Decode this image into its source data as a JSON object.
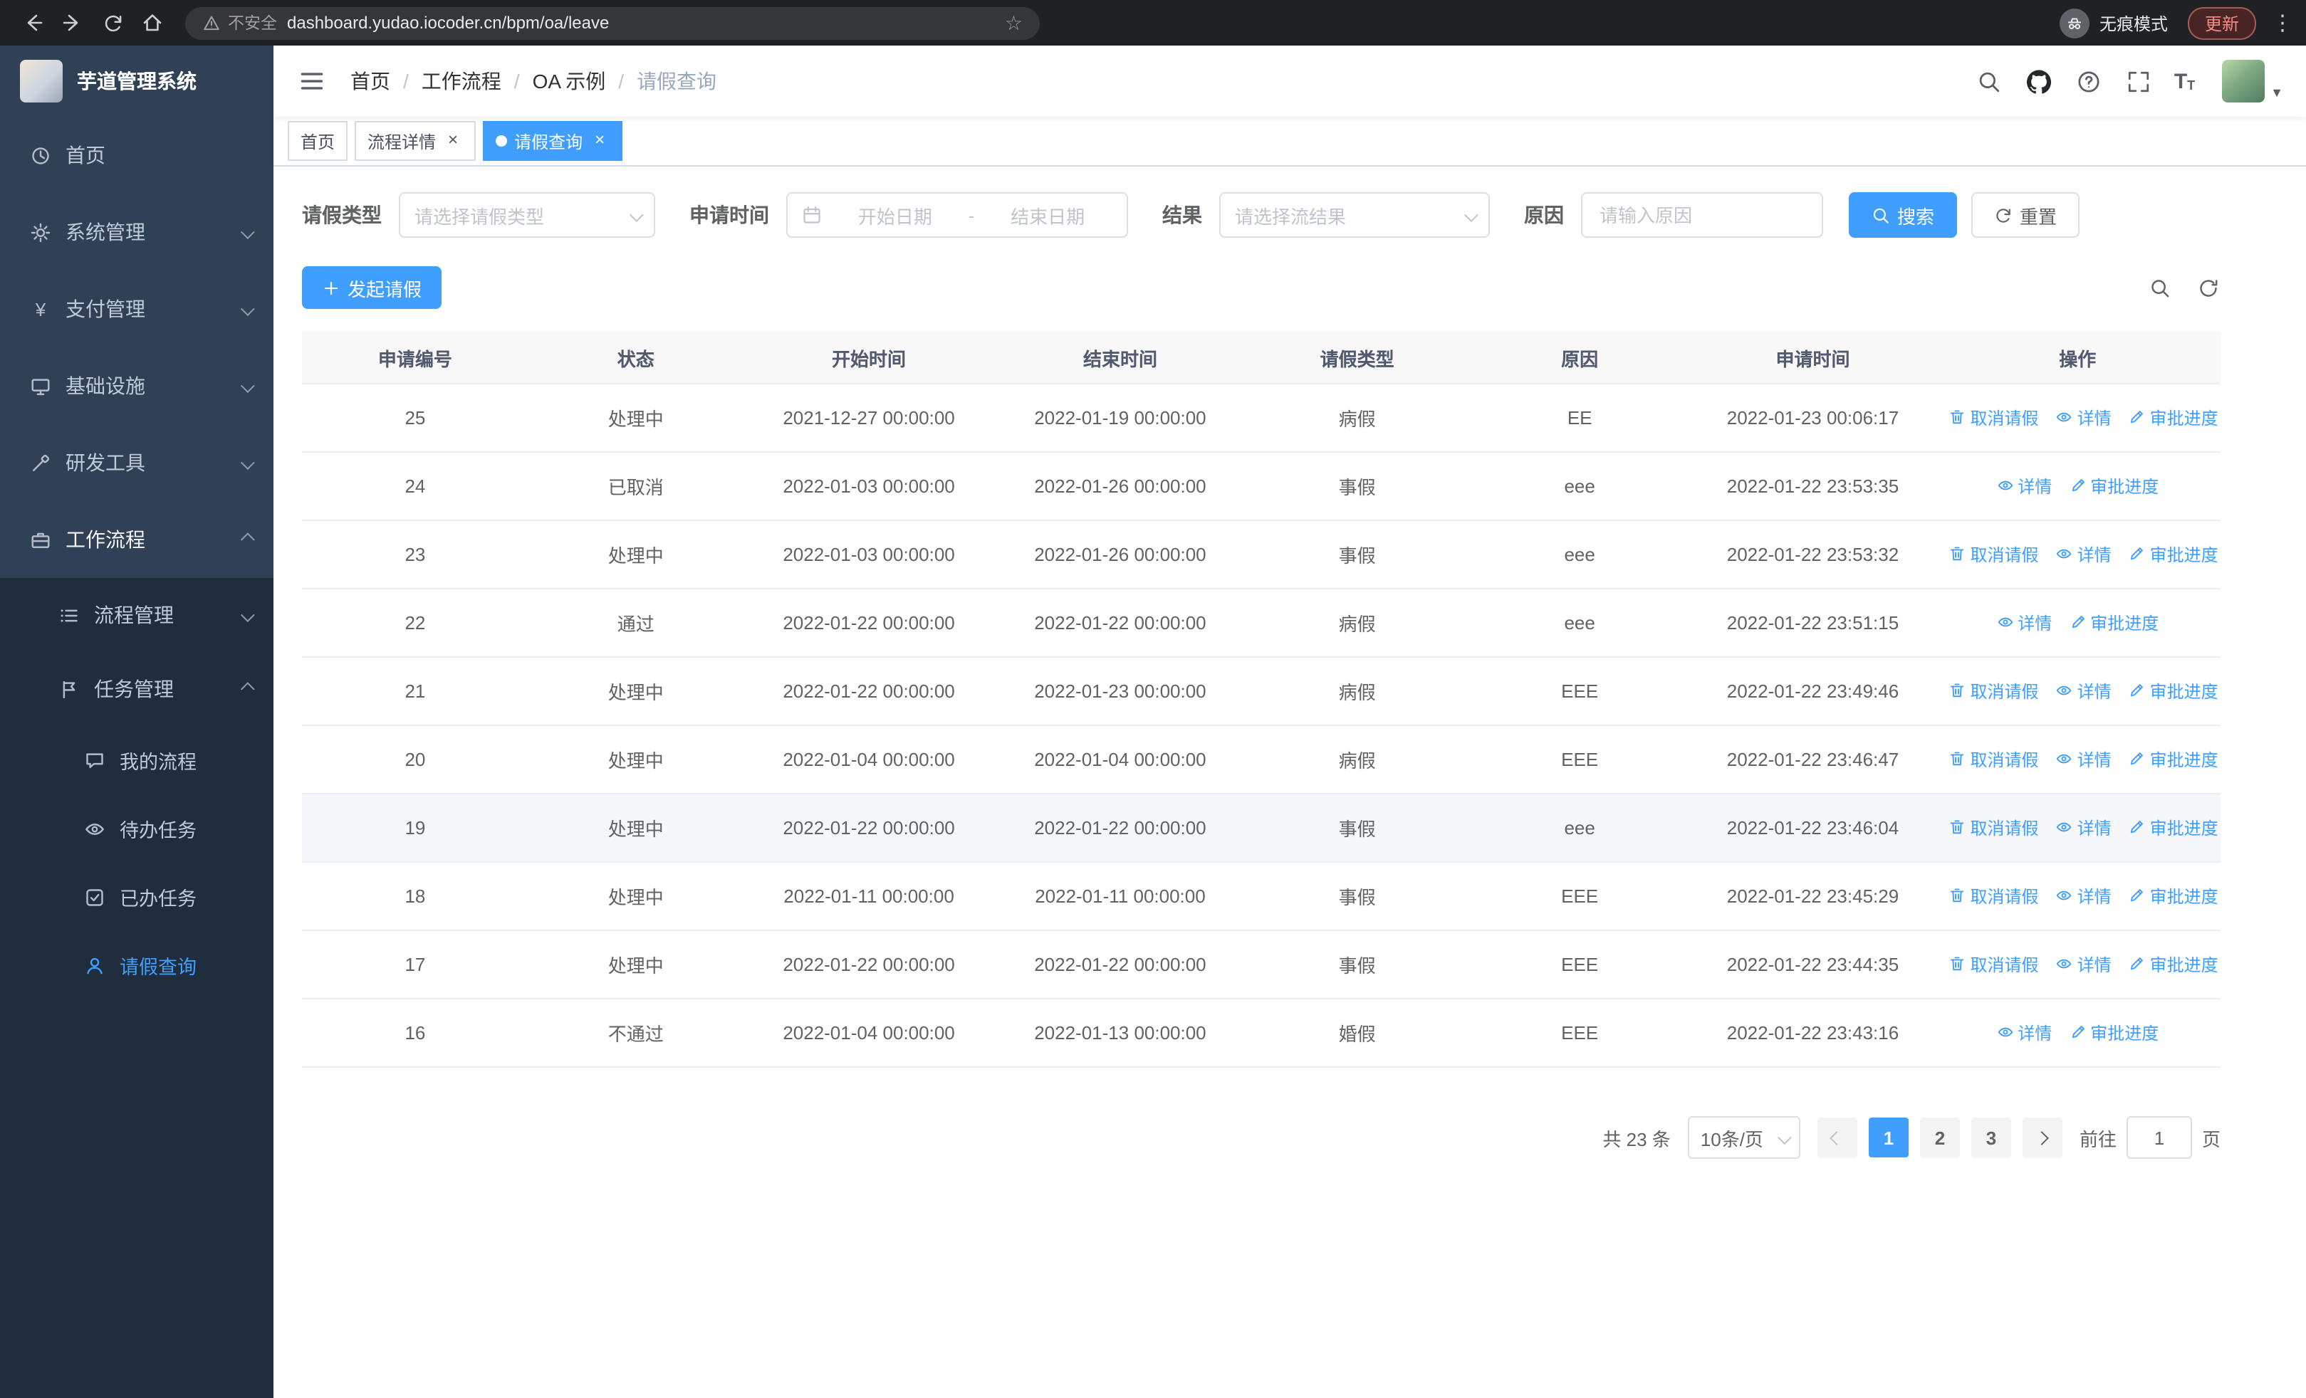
{
  "colors": {
    "primary": "#409eff",
    "sidebar_bg": "#304156",
    "submenu_bg": "#1f2d3d",
    "header_row_bg": "#f8f8f9"
  },
  "browser": {
    "security_warning": "不安全",
    "url": "dashboard.yudao.iocoder.cn/bpm/oa/leave",
    "incognito_label": "无痕模式",
    "update_label": "更新"
  },
  "sidebar": {
    "app_title": "芋道管理系统",
    "items": [
      {
        "label": "首页",
        "icon": "dashboard-icon"
      },
      {
        "label": "系统管理",
        "icon": "gear-icon"
      },
      {
        "label": "支付管理",
        "icon": "payment-icon"
      },
      {
        "label": "基础设施",
        "icon": "infrastructure-icon"
      },
      {
        "label": "研发工具",
        "icon": "devtools-icon"
      },
      {
        "label": "工作流程",
        "icon": "workflow-icon",
        "expanded": true,
        "children": [
          {
            "label": "流程管理",
            "icon": "process-icon"
          },
          {
            "label": "任务管理",
            "icon": "task-icon",
            "expanded": true,
            "children": [
              {
                "label": "我的流程",
                "icon": "my-process-icon"
              },
              {
                "label": "待办任务",
                "icon": "todo-icon"
              },
              {
                "label": "已办任务",
                "icon": "done-icon"
              },
              {
                "label": "请假查询",
                "icon": "person-icon",
                "active": true
              }
            ]
          }
        ]
      }
    ]
  },
  "navbar": {
    "breadcrumb": [
      "首页",
      "工作流程",
      "OA 示例",
      "请假查询"
    ],
    "separator": "/",
    "icons": [
      "search-icon",
      "github-icon",
      "help-icon",
      "fullscreen-icon",
      "font-size-icon",
      "avatar"
    ]
  },
  "tags": [
    {
      "label": "首页",
      "closable": false,
      "active": false
    },
    {
      "label": "流程详情",
      "closable": true,
      "active": false
    },
    {
      "label": "请假查询",
      "closable": true,
      "active": true
    }
  ],
  "filters": {
    "leave_type_label": "请假类型",
    "leave_type_placeholder": "请选择请假类型",
    "apply_time_label": "申请时间",
    "start_date_placeholder": "开始日期",
    "date_separator": "-",
    "end_date_placeholder": "结束日期",
    "result_label": "结果",
    "result_placeholder": "请选择流结果",
    "reason_label": "原因",
    "reason_placeholder": "请输入原因",
    "search_label": "搜索",
    "reset_label": "重置"
  },
  "actions": {
    "create_label": "发起请假"
  },
  "table": {
    "columns": [
      "申请编号",
      "状态",
      "开始时间",
      "结束时间",
      "请假类型",
      "原因",
      "申请时间",
      "操作"
    ],
    "ops_labels": {
      "cancel": "取消请假",
      "detail": "详情",
      "progress": "审批进度"
    },
    "rows": [
      {
        "id": "25",
        "status": "处理中",
        "start": "2021-12-27 00:00:00",
        "end": "2022-01-19 00:00:00",
        "type": "病假",
        "reason": "EE",
        "applied": "2022-01-23 00:06:17",
        "ops": [
          "cancel",
          "detail",
          "progress"
        ]
      },
      {
        "id": "24",
        "status": "已取消",
        "start": "2022-01-03 00:00:00",
        "end": "2022-01-26 00:00:00",
        "type": "事假",
        "reason": "eee",
        "applied": "2022-01-22 23:53:35",
        "ops": [
          "detail",
          "progress"
        ]
      },
      {
        "id": "23",
        "status": "处理中",
        "start": "2022-01-03 00:00:00",
        "end": "2022-01-26 00:00:00",
        "type": "事假",
        "reason": "eee",
        "applied": "2022-01-22 23:53:32",
        "ops": [
          "cancel",
          "detail",
          "progress"
        ]
      },
      {
        "id": "22",
        "status": "通过",
        "start": "2022-01-22 00:00:00",
        "end": "2022-01-22 00:00:00",
        "type": "病假",
        "reason": "eee",
        "applied": "2022-01-22 23:51:15",
        "ops": [
          "detail",
          "progress"
        ]
      },
      {
        "id": "21",
        "status": "处理中",
        "start": "2022-01-22 00:00:00",
        "end": "2022-01-23 00:00:00",
        "type": "病假",
        "reason": "EEE",
        "applied": "2022-01-22 23:49:46",
        "ops": [
          "cancel",
          "detail",
          "progress"
        ]
      },
      {
        "id": "20",
        "status": "处理中",
        "start": "2022-01-04 00:00:00",
        "end": "2022-01-04 00:00:00",
        "type": "病假",
        "reason": "EEE",
        "applied": "2022-01-22 23:46:47",
        "ops": [
          "cancel",
          "detail",
          "progress"
        ]
      },
      {
        "id": "19",
        "status": "处理中",
        "start": "2022-01-22 00:00:00",
        "end": "2022-01-22 00:00:00",
        "type": "事假",
        "reason": "eee",
        "applied": "2022-01-22 23:46:04",
        "ops": [
          "cancel",
          "detail",
          "progress"
        ],
        "hover": true
      },
      {
        "id": "18",
        "status": "处理中",
        "start": "2022-01-11 00:00:00",
        "end": "2022-01-11 00:00:00",
        "type": "事假",
        "reason": "EEE",
        "applied": "2022-01-22 23:45:29",
        "ops": [
          "cancel",
          "detail",
          "progress"
        ]
      },
      {
        "id": "17",
        "status": "处理中",
        "start": "2022-01-22 00:00:00",
        "end": "2022-01-22 00:00:00",
        "type": "事假",
        "reason": "EEE",
        "applied": "2022-01-22 23:44:35",
        "ops": [
          "cancel",
          "detail",
          "progress"
        ]
      },
      {
        "id": "16",
        "status": "不通过",
        "start": "2022-01-04 00:00:00",
        "end": "2022-01-13 00:00:00",
        "type": "婚假",
        "reason": "EEE",
        "applied": "2022-01-22 23:43:16",
        "ops": [
          "detail",
          "progress"
        ]
      }
    ]
  },
  "pagination": {
    "total_label": "共 23 条",
    "page_size": "10条/页",
    "pages": [
      "1",
      "2",
      "3"
    ],
    "active_page": "1",
    "goto_label": "前往",
    "goto_value": "1",
    "goto_suffix": "页"
  }
}
